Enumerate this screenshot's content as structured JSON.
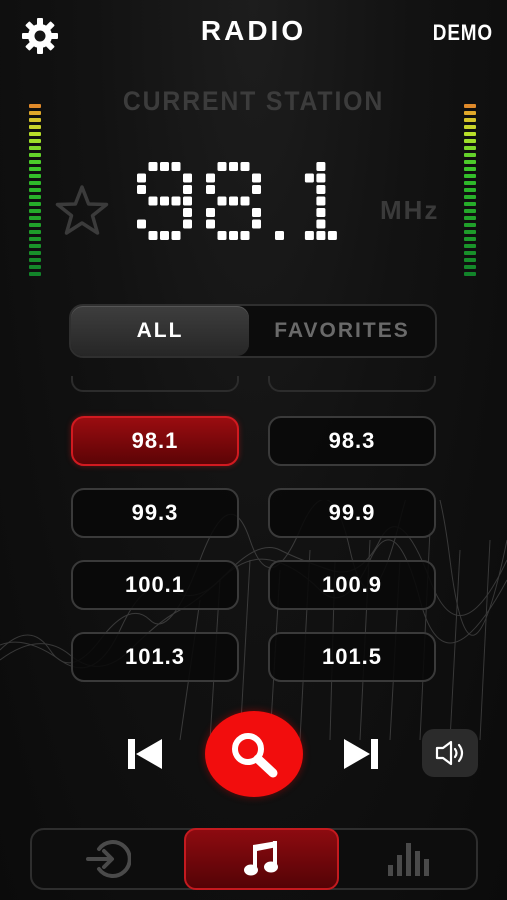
{
  "header": {
    "title": "RADIO",
    "demo_label": "DEMO",
    "settings_icon": "gear-icon"
  },
  "display": {
    "current_station_label": "CURRENT STATION",
    "frequency": "98.1",
    "unit": "MHz",
    "favorite_icon": "star-outline-icon"
  },
  "tabs": {
    "all": "ALL",
    "favorites": "FAVORITES",
    "selected": "ALL"
  },
  "stations": {
    "rows": [
      [
        "98.1",
        "98.3"
      ],
      [
        "99.3",
        "99.9"
      ],
      [
        "100.1",
        "100.9"
      ],
      [
        "101.3",
        "101.5"
      ]
    ],
    "selected": "98.1"
  },
  "controls": {
    "prev_icon": "skip-previous-icon",
    "search_icon": "search-icon",
    "next_icon": "skip-next-icon",
    "volume_icon": "volume-icon"
  },
  "bottom_nav": {
    "items": [
      "input-icon",
      "music-note-icon",
      "equalizer-icon"
    ],
    "selected": "music-note-icon"
  },
  "colors": {
    "accent": "#f20d0d",
    "active_station": "#8a0a0e",
    "muted_text": "#3c3c3c"
  }
}
